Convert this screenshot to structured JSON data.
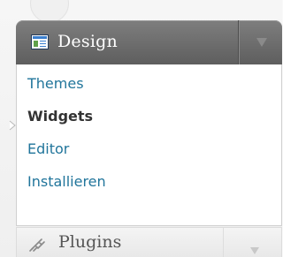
{
  "menu": {
    "design": {
      "label": "Design",
      "icon": "design-icon",
      "toggle_icon": "triangle-down-icon",
      "items": [
        {
          "label": "Themes",
          "current": false
        },
        {
          "label": "Widgets",
          "current": true
        },
        {
          "label": "Editor",
          "current": false
        },
        {
          "label": "Installieren",
          "current": false
        }
      ]
    },
    "plugins": {
      "label": "Plugins",
      "icon": "plugin-icon",
      "toggle_icon": "triangle-down-icon"
    }
  },
  "colors": {
    "header_bg": "#6e6e6e",
    "link": "#21759b",
    "current_text": "#333333"
  }
}
